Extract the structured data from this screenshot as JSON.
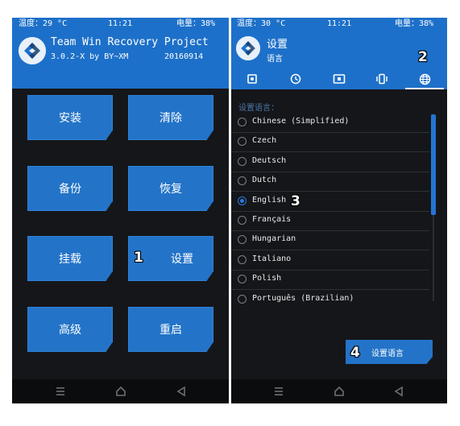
{
  "left": {
    "status": {
      "temp": "温度：29 °C",
      "time": "11:21",
      "battery": "电量：38%"
    },
    "header": {
      "title": "Team Win Recovery Project",
      "version": "3.0.2-X by BY~XM",
      "build": "20160914"
    },
    "buttons": {
      "install": "安装",
      "wipe": "清除",
      "backup": "备份",
      "restore": "恢复",
      "mount": "挂载",
      "settings": "设置",
      "advanced": "高级",
      "reboot": "重启"
    },
    "annotation": "1"
  },
  "right": {
    "status": {
      "temp": "温度：30 °C",
      "time": "11:21",
      "battery": "电量：38%"
    },
    "header": {
      "title": "设置",
      "subtitle": "语言"
    },
    "tabs": [
      "general-settings-icon",
      "time-zone-icon",
      "screen-icon",
      "vibration-icon",
      "language-globe-icon"
    ],
    "active_tab": 4,
    "section_label": "设置语言：",
    "languages": [
      "Chinese (Simplified)",
      "Czech",
      "Deutsch",
      "Dutch",
      "English",
      "Français",
      "Hungarian",
      "Italiano",
      "Polish",
      "Português (Brazilian)"
    ],
    "selected_language": "English",
    "action_button": "设置语言",
    "annotations": {
      "tab": "2",
      "selection": "3",
      "action": "4"
    }
  },
  "colors": {
    "accent": "#1d70c9",
    "button": "#2374c8",
    "background": "#151619",
    "navbar": "#0b0c0d"
  }
}
